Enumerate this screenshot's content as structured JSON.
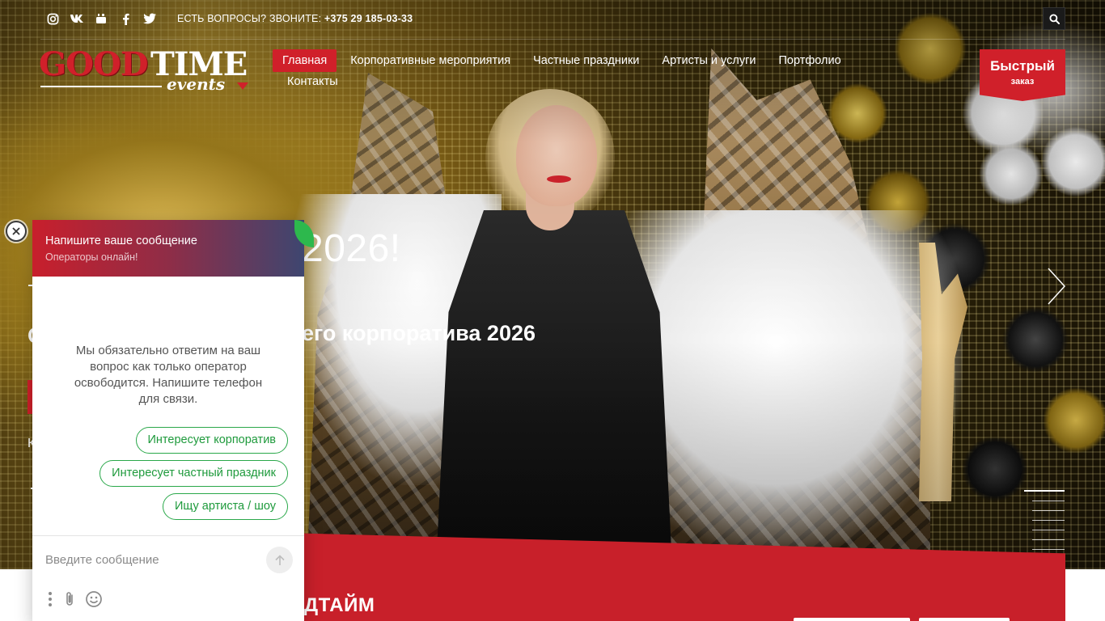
{
  "topbar": {
    "socials": [
      {
        "name": "instagram-icon",
        "glyph": "◎"
      },
      {
        "name": "vk-icon",
        "glyph": "VK"
      },
      {
        "name": "youtube-icon",
        "glyph": "▶"
      },
      {
        "name": "facebook-icon",
        "glyph": "f"
      },
      {
        "name": "twitter-icon",
        "glyph": "🐦"
      }
    ],
    "question_text": "ЕСТЬ ВОПРОСЫ? ЗВОНИТЕ: ",
    "phone": "+375 29 185-03-33"
  },
  "logo": {
    "good": "GOOD",
    "time": "TIME",
    "events": "events"
  },
  "nav": {
    "items": [
      {
        "label": "Главная",
        "active": true
      },
      {
        "label": "Корпоративные мероприятия"
      },
      {
        "label": "Частные праздники"
      },
      {
        "label": "Артисты и услуги"
      },
      {
        "label": "Портфолио"
      },
      {
        "label": "Контакты"
      }
    ]
  },
  "quick_order": {
    "line1": "Быстрый",
    "line2": "заказ"
  },
  "hero": {
    "title_visible": "2026!",
    "subtitle_lead": "О",
    "subtitle_visible": "его корпоратива 2026",
    "small_text": "К"
  },
  "ribbon": {
    "title_visible": "ДТАЙМ"
  },
  "chat": {
    "header_title": "Напишите ваше сообщение",
    "header_status": "Операторы онлайн!",
    "message": "Мы обязательно ответим на ваш вопрос как только оператор освободится. Напишите телефон для связи.",
    "quick_replies": [
      "Интересует корпоратив",
      "Интересует частный праздник",
      "Ищу артиста / шоу"
    ],
    "input_placeholder": "Введите сообщение"
  },
  "colors": {
    "brand_red": "#d0202a",
    "chat_green": "#2aa84a"
  }
}
